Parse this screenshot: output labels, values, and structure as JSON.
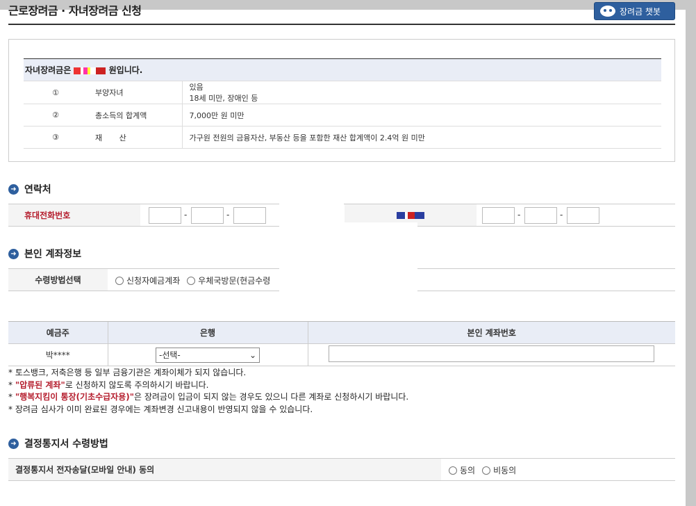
{
  "header": {
    "title": "근로장려금 · 자녀장려금 신청",
    "bot_button": "장려금 챗봇"
  },
  "info": {
    "head_prefix": "자녀장려금은 ",
    "head_suffix": "원입니다.",
    "rows": [
      {
        "num": "①",
        "label": "부양자녀",
        "value_line1": "있음",
        "value_line2": "18세 미만, 장애인 등"
      },
      {
        "num": "②",
        "label": "총소득의 합계액",
        "value_line1": "7,000만 원 미만",
        "value_line2": ""
      },
      {
        "num": "③",
        "label": "재       산",
        "value_line1": "가구원 전원의 금융자산, 부동산 등을 포함한 재산 합계액이 2.4억 원 미만",
        "value_line2": ""
      }
    ]
  },
  "contact": {
    "section_title": "연락처",
    "mobile_label": "휴대전화번호",
    "dash": "-"
  },
  "account": {
    "section_title": "본인 계좌정보",
    "method_label": "수령방법선택",
    "method_options": [
      "신청자예금계좌",
      "우체국방문(현금수령"
    ],
    "col_holder": "예금주",
    "col_bank": "은행",
    "col_number": "본인 계좌번호",
    "holder_value": "박****",
    "bank_select": "-선택-"
  },
  "notes": {
    "n1": "* 토스뱅크, 저축은행 등 일부 금융기관은 계좌이체가 되지 않습니다.",
    "n2_red": "\"압류된 계좌\"",
    "n2_rest": "로 신청하지 않도록 주의하시기 바랍니다.",
    "n3_red": "\"행복지킴이 통장(기초수급자용)\"",
    "n3_rest": "은 장려금이 입금이 되지 않는 경우도 있으니 다른 계좌로 신청하시기 바랍니다.",
    "n4": "* 장려금 심사가 이미 완료된 경우에는 계좌변경 신고내용이 반영되지 않을 수 있습니다.",
    "star": "* "
  },
  "decision": {
    "section_title": "결정통지서 수령방법",
    "consent_label": "결정통지서 전자송달(모바일 안내) 동의",
    "options": [
      "동의",
      "비동의"
    ]
  },
  "colors": {
    "accent": "#2e5f9e",
    "warning": "#b51e2e",
    "header_bg": "#e9edf6"
  }
}
